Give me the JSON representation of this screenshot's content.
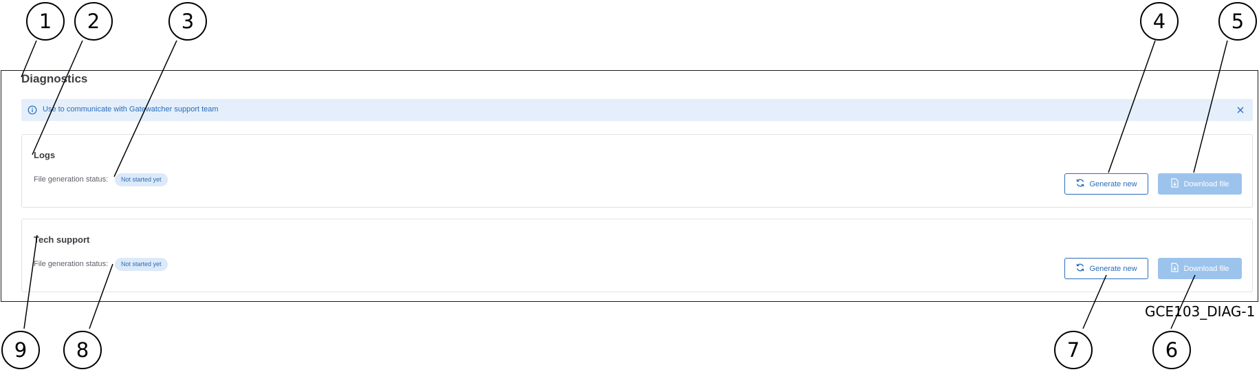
{
  "page": {
    "title": "Diagnostics"
  },
  "banner": {
    "text": "Use to communicate with Gatewatcher support team",
    "info_icon": "info-circle-icon",
    "close_icon": "close-icon"
  },
  "cards": [
    {
      "title": "Logs",
      "status_label": "File generation status:",
      "status_value": "Not started yet",
      "generate_label": "Generate new",
      "download_label": "Download file"
    },
    {
      "title": "Tech support",
      "status_label": "File generation status:",
      "status_value": "Not started yet",
      "generate_label": "Generate new",
      "download_label": "Download file"
    }
  ],
  "callouts": [
    "1",
    "2",
    "3",
    "4",
    "5",
    "6",
    "7",
    "8",
    "9"
  ],
  "figure_ref": "GCE103_DIAG-1",
  "colors": {
    "accent": "#2a6cb8",
    "banner_bg": "#e4effb",
    "badge_bg": "#dce9f8",
    "disabled_button": "#9cc3ec"
  }
}
